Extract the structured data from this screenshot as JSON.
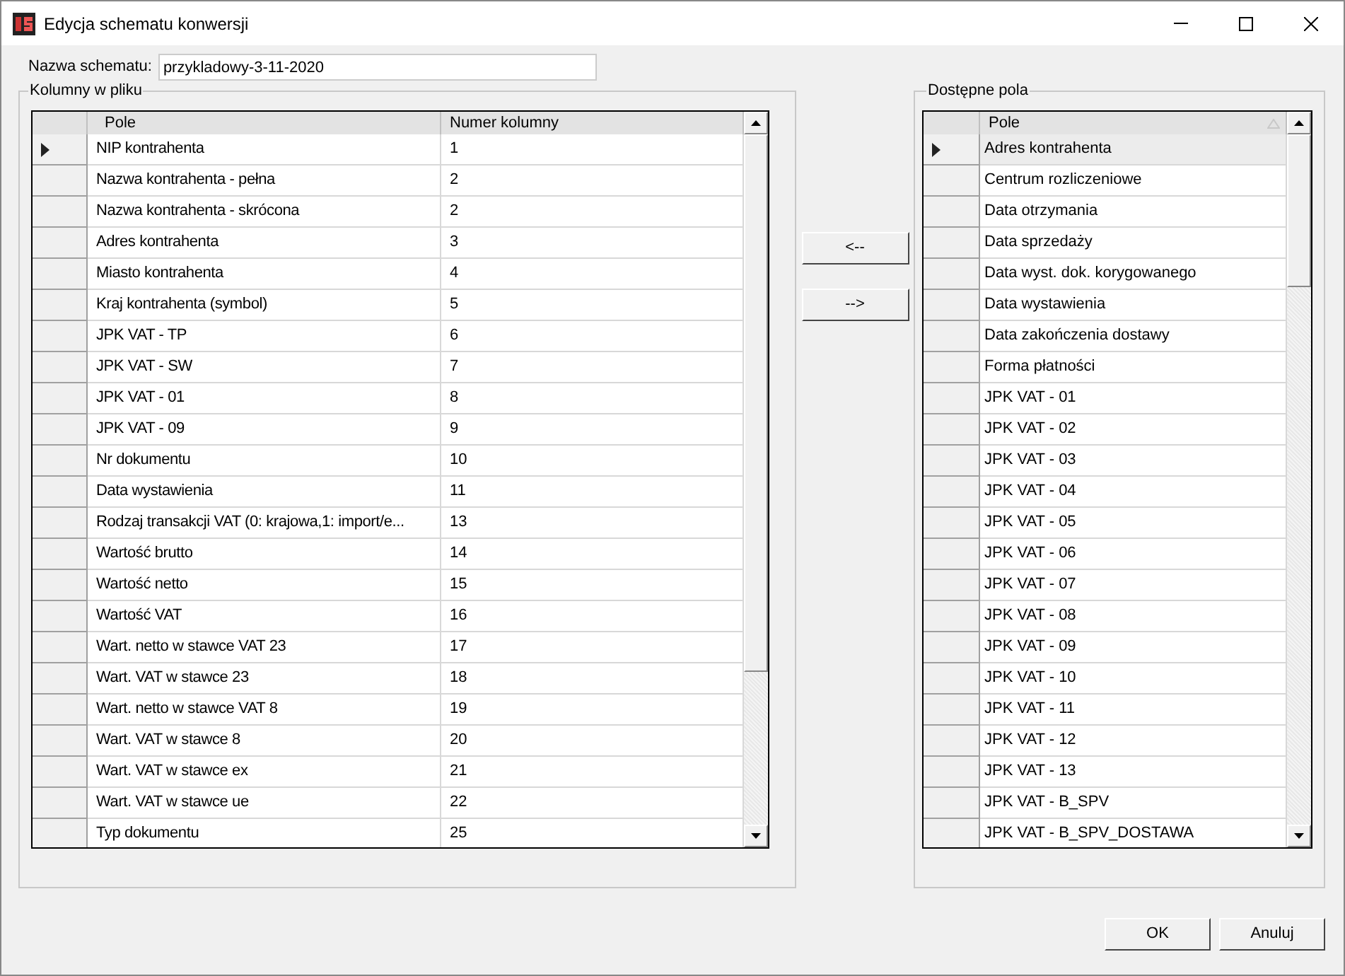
{
  "window": {
    "title": "Edycja schematu konwersji"
  },
  "schema_name": {
    "label": "Nazwa schematu:",
    "value": "przykladowy-3-11-2020"
  },
  "file_columns": {
    "title": "Kolumny w pliku",
    "columns": [
      {
        "label": "Pole"
      },
      {
        "label": "Numer kolumny"
      }
    ],
    "rows": [
      {
        "field": "NIP kontrahenta",
        "number": "1",
        "selected": true
      },
      {
        "field": "Nazwa kontrahenta - pełna",
        "number": "2",
        "selected": false
      },
      {
        "field": "Nazwa kontrahenta - skrócona",
        "number": "2",
        "selected": false
      },
      {
        "field": "Adres kontrahenta",
        "number": "3",
        "selected": false
      },
      {
        "field": "Miasto kontrahenta",
        "number": "4",
        "selected": false
      },
      {
        "field": "Kraj kontrahenta (symbol)",
        "number": "5",
        "selected": false
      },
      {
        "field": "JPK VAT - TP",
        "number": "6",
        "selected": false
      },
      {
        "field": "JPK VAT - SW",
        "number": "7",
        "selected": false
      },
      {
        "field": "JPK VAT - 01",
        "number": "8",
        "selected": false
      },
      {
        "field": "JPK VAT - 09",
        "number": "9",
        "selected": false
      },
      {
        "field": "Nr dokumentu",
        "number": "10",
        "selected": false
      },
      {
        "field": "Data wystawienia",
        "number": "11",
        "selected": false
      },
      {
        "field": "Rodzaj transakcji VAT (0: krajowa,1: import/e...",
        "number": "13",
        "selected": false
      },
      {
        "field": "Wartość brutto",
        "number": "14",
        "selected": false
      },
      {
        "field": "Wartość netto",
        "number": "15",
        "selected": false
      },
      {
        "field": "Wartość VAT",
        "number": "16",
        "selected": false
      },
      {
        "field": "Wart. netto w stawce VAT 23",
        "number": "17",
        "selected": false
      },
      {
        "field": "Wart. VAT w stawce 23",
        "number": "18",
        "selected": false
      },
      {
        "field": "Wart. netto w stawce VAT 8",
        "number": "19",
        "selected": false
      },
      {
        "field": "Wart. VAT w stawce 8",
        "number": "20",
        "selected": false
      },
      {
        "field": "Wart. VAT w stawce ex",
        "number": "21",
        "selected": false
      },
      {
        "field": "Wart. VAT w stawce ue",
        "number": "22",
        "selected": false
      },
      {
        "field": "Typ dokumentu",
        "number": "25",
        "selected": false
      }
    ]
  },
  "move_buttons": [
    "<--",
    "-->"
  ],
  "available_fields": {
    "title": "Dostępne pola",
    "columns": [
      {
        "label": "Pole"
      }
    ],
    "rows": [
      {
        "field": "Adres kontrahenta",
        "selected": true
      },
      {
        "field": "Centrum rozliczeniowe",
        "selected": false
      },
      {
        "field": "Data otrzymania",
        "selected": false
      },
      {
        "field": "Data sprzedaży",
        "selected": false
      },
      {
        "field": "Data wyst. dok. korygowanego",
        "selected": false
      },
      {
        "field": "Data wystawienia",
        "selected": false
      },
      {
        "field": "Data zakończenia dostawy",
        "selected": false
      },
      {
        "field": "Forma płatności",
        "selected": false
      },
      {
        "field": "JPK VAT - 01",
        "selected": false
      },
      {
        "field": "JPK VAT - 02",
        "selected": false
      },
      {
        "field": "JPK VAT - 03",
        "selected": false
      },
      {
        "field": "JPK VAT - 04",
        "selected": false
      },
      {
        "field": "JPK VAT - 05",
        "selected": false
      },
      {
        "field": "JPK VAT - 06",
        "selected": false
      },
      {
        "field": "JPK VAT - 07",
        "selected": false
      },
      {
        "field": "JPK VAT - 08",
        "selected": false
      },
      {
        "field": "JPK VAT - 09",
        "selected": false
      },
      {
        "field": "JPK VAT - 10",
        "selected": false
      },
      {
        "field": "JPK VAT - 11",
        "selected": false
      },
      {
        "field": "JPK VAT - 12",
        "selected": false
      },
      {
        "field": "JPK VAT - 13",
        "selected": false
      },
      {
        "field": "JPK VAT - B_SPV",
        "selected": false
      },
      {
        "field": "JPK VAT - B_SPV_DOSTAWA",
        "selected": false
      }
    ]
  },
  "buttons": [
    "OK",
    "Anuluj"
  ]
}
